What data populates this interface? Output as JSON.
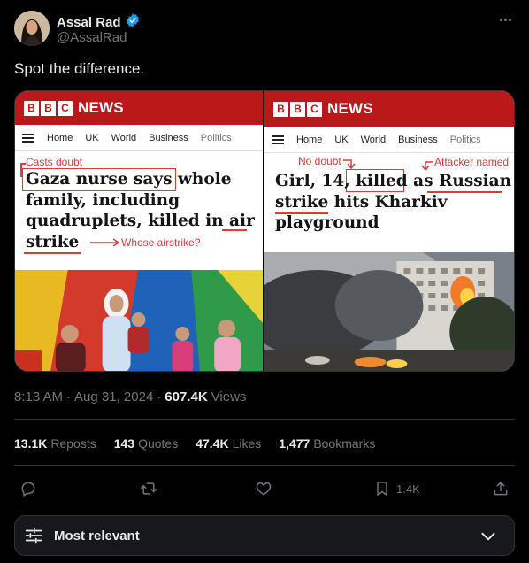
{
  "author": {
    "display_name": "Assal Rad",
    "handle": "@AssalRad",
    "verified": true
  },
  "tweet": {
    "text": "Spot the difference.",
    "time": "8:13 AM",
    "date": "Aug 31, 2024",
    "views_count": "607.4K",
    "views_label": "Views"
  },
  "media": {
    "left": {
      "brand_boxes": [
        "B",
        "B",
        "C"
      ],
      "brand_word": "NEWS",
      "nav": [
        "Home",
        "UK",
        "World",
        "Business",
        "Politics"
      ],
      "headline_lines": [
        "Gaza nurse says whole",
        "family, including",
        "quadruplets, killed in air",
        "strike"
      ],
      "annotation_top": "Casts doubt",
      "annotation_bottom": "Whose airstrike?"
    },
    "right": {
      "brand_boxes": [
        "B",
        "B",
        "C"
      ],
      "brand_word": "NEWS",
      "nav": [
        "Home",
        "UK",
        "World",
        "Business",
        "Politics"
      ],
      "headline_lines": [
        "Girl, 14, killed as Russian",
        "strike hits Kharkiv",
        "playground"
      ],
      "annotation_left": "No doubt",
      "annotation_right": "Attacker named"
    }
  },
  "stats": {
    "reposts_count": "13.1K",
    "reposts_label": "Reposts",
    "quotes_count": "143",
    "quotes_label": "Quotes",
    "likes_count": "47.4K",
    "likes_label": "Likes",
    "bookmarks_count": "1,477",
    "bookmarks_label": "Bookmarks"
  },
  "actions": {
    "bookmark_count": "1.4K",
    "icons": [
      "reply-icon",
      "repost-icon",
      "like-icon",
      "bookmark-icon",
      "share-icon"
    ]
  },
  "sort": {
    "label": "Most relevant"
  },
  "colors": {
    "background": "#000000",
    "text": "#e7e9ea",
    "muted": "#71767b",
    "verified": "#1d9bf0",
    "bbc_red": "#bb1919",
    "annotation_red": "#e03a3a"
  }
}
